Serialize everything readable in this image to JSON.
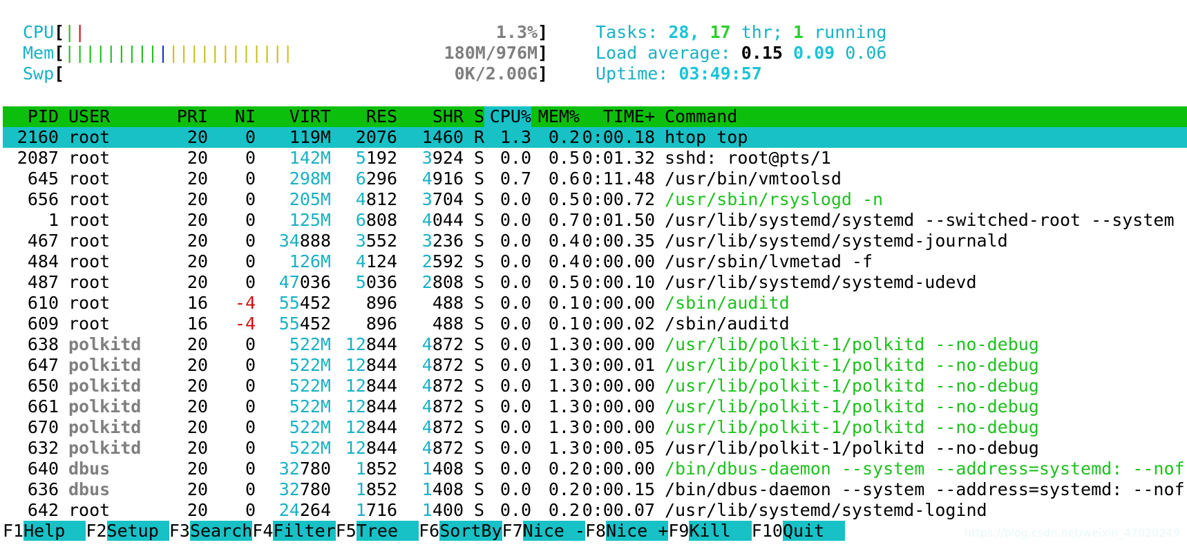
{
  "meters": {
    "cpu": {
      "label": "CPU",
      "bar_segments": [
        {
          "text": "|",
          "color": "green"
        },
        {
          "text": "|",
          "color": "red"
        }
      ],
      "value": "1.3%"
    },
    "mem": {
      "label": "Mem",
      "bar_segments": [
        {
          "text": "|||||||||",
          "color": "green"
        },
        {
          "text": "|",
          "color": "blue"
        },
        {
          "text": "||||||||||||",
          "color": "yellow"
        }
      ],
      "value": "180M/976M"
    },
    "swp": {
      "label": "Swp",
      "bar_segments": [],
      "value": "0K/2.00G"
    }
  },
  "stats": {
    "tasks_label": "Tasks: ",
    "tasks_count": "28",
    "threads": "17",
    "thr_label": " thr; ",
    "running": "1",
    "running_label": " running",
    "load_label": "Load average: ",
    "load1": "0.15",
    "load5": "0.09",
    "load15": "0.06",
    "uptime_label": "Uptime: ",
    "uptime": "03:49:57"
  },
  "table": {
    "headers": {
      "pid": "PID",
      "user": "USER",
      "pri": "PRI",
      "ni": "NI",
      "virt": "VIRT",
      "res": "RES",
      "shr": "SHR",
      "s": "S",
      "cpu": "CPU%",
      "mem": "MEM%",
      "time": "TIME+",
      "command": "Command"
    },
    "rows": [
      {
        "pid": "2160",
        "user": "root",
        "pri": "20",
        "ni": "0",
        "virt": "119M",
        "res": "2076",
        "shr": "1460",
        "s": "R",
        "cpu": "1.3",
        "mem": "0.2",
        "time": "0:00.18",
        "command": "htop top",
        "selected": true
      },
      {
        "pid": "2087",
        "user": "root",
        "pri": "20",
        "ni": "0",
        "virt": "142M",
        "res": "5192",
        "shr": "3924",
        "s": "S",
        "cpu": "0.0",
        "mem": "0.5",
        "time": "0:01.32",
        "command": "sshd: root@pts/1"
      },
      {
        "pid": "645",
        "user": "root",
        "pri": "20",
        "ni": "0",
        "virt": "298M",
        "res": "6296",
        "shr": "4916",
        "s": "S",
        "cpu": "0.7",
        "mem": "0.6",
        "time": "0:11.48",
        "command": "/usr/bin/vmtoolsd"
      },
      {
        "pid": "656",
        "user": "root",
        "pri": "20",
        "ni": "0",
        "virt": "205M",
        "res": "4812",
        "shr": "3704",
        "s": "S",
        "cpu": "0.0",
        "mem": "0.5",
        "time": "0:00.72",
        "command": "/usr/sbin/rsyslogd -n",
        "cmd_green": true
      },
      {
        "pid": "1",
        "user": "root",
        "pri": "20",
        "ni": "0",
        "virt": "125M",
        "res": "6808",
        "shr": "4044",
        "s": "S",
        "cpu": "0.0",
        "mem": "0.7",
        "time": "0:01.50",
        "command": "/usr/lib/systemd/systemd --switched-root --system"
      },
      {
        "pid": "467",
        "user": "root",
        "pri": "20",
        "ni": "0",
        "virt": "34888",
        "res": "3552",
        "shr": "3236",
        "s": "S",
        "cpu": "0.0",
        "mem": "0.4",
        "time": "0:00.35",
        "command": "/usr/lib/systemd/systemd-journald"
      },
      {
        "pid": "484",
        "user": "root",
        "pri": "20",
        "ni": "0",
        "virt": "126M",
        "res": "4124",
        "shr": "2592",
        "s": "S",
        "cpu": "0.0",
        "mem": "0.4",
        "time": "0:00.00",
        "command": "/usr/sbin/lvmetad -f"
      },
      {
        "pid": "487",
        "user": "root",
        "pri": "20",
        "ni": "0",
        "virt": "47036",
        "res": "5036",
        "shr": "2808",
        "s": "S",
        "cpu": "0.0",
        "mem": "0.5",
        "time": "0:00.10",
        "command": "/usr/lib/systemd/systemd-udevd"
      },
      {
        "pid": "610",
        "user": "root",
        "pri": "16",
        "ni": "-4",
        "virt": "55452",
        "res": "896",
        "shr": "488",
        "s": "S",
        "cpu": "0.0",
        "mem": "0.1",
        "time": "0:00.00",
        "command": "/sbin/auditd",
        "cmd_green": true
      },
      {
        "pid": "609",
        "user": "root",
        "pri": "16",
        "ni": "-4",
        "virt": "55452",
        "res": "896",
        "shr": "488",
        "s": "S",
        "cpu": "0.0",
        "mem": "0.1",
        "time": "0:00.02",
        "command": "/sbin/auditd"
      },
      {
        "pid": "638",
        "user": "polkitd",
        "pri": "20",
        "ni": "0",
        "virt": "522M",
        "res": "12844",
        "shr": "4872",
        "s": "S",
        "cpu": "0.0",
        "mem": "1.3",
        "time": "0:00.00",
        "command": "/usr/lib/polkit-1/polkitd --no-debug",
        "cmd_green": true
      },
      {
        "pid": "647",
        "user": "polkitd",
        "pri": "20",
        "ni": "0",
        "virt": "522M",
        "res": "12844",
        "shr": "4872",
        "s": "S",
        "cpu": "0.0",
        "mem": "1.3",
        "time": "0:00.01",
        "command": "/usr/lib/polkit-1/polkitd --no-debug",
        "cmd_green": true
      },
      {
        "pid": "650",
        "user": "polkitd",
        "pri": "20",
        "ni": "0",
        "virt": "522M",
        "res": "12844",
        "shr": "4872",
        "s": "S",
        "cpu": "0.0",
        "mem": "1.3",
        "time": "0:00.00",
        "command": "/usr/lib/polkit-1/polkitd --no-debug",
        "cmd_green": true
      },
      {
        "pid": "661",
        "user": "polkitd",
        "pri": "20",
        "ni": "0",
        "virt": "522M",
        "res": "12844",
        "shr": "4872",
        "s": "S",
        "cpu": "0.0",
        "mem": "1.3",
        "time": "0:00.00",
        "command": "/usr/lib/polkit-1/polkitd --no-debug",
        "cmd_green": true
      },
      {
        "pid": "670",
        "user": "polkitd",
        "pri": "20",
        "ni": "0",
        "virt": "522M",
        "res": "12844",
        "shr": "4872",
        "s": "S",
        "cpu": "0.0",
        "mem": "1.3",
        "time": "0:00.00",
        "command": "/usr/lib/polkit-1/polkitd --no-debug",
        "cmd_green": true
      },
      {
        "pid": "632",
        "user": "polkitd",
        "pri": "20",
        "ni": "0",
        "virt": "522M",
        "res": "12844",
        "shr": "4872",
        "s": "S",
        "cpu": "0.0",
        "mem": "1.3",
        "time": "0:00.05",
        "command": "/usr/lib/polkit-1/polkitd --no-debug"
      },
      {
        "pid": "640",
        "user": "dbus",
        "pri": "20",
        "ni": "0",
        "virt": "32780",
        "res": "1852",
        "shr": "1408",
        "s": "S",
        "cpu": "0.0",
        "mem": "0.2",
        "time": "0:00.00",
        "command": "/bin/dbus-daemon --system --address=systemd: --nof",
        "cmd_green": true
      },
      {
        "pid": "636",
        "user": "dbus",
        "pri": "20",
        "ni": "0",
        "virt": "32780",
        "res": "1852",
        "shr": "1408",
        "s": "S",
        "cpu": "0.0",
        "mem": "0.2",
        "time": "0:00.15",
        "command": "/bin/dbus-daemon --system --address=systemd: --nof"
      },
      {
        "pid": "642",
        "user": "root",
        "pri": "20",
        "ni": "0",
        "virt": "24264",
        "res": "1716",
        "shr": "1400",
        "s": "S",
        "cpu": "0.0",
        "mem": "0.2",
        "time": "0:00.07",
        "command": "/usr/lib/systemd/systemd-logind"
      }
    ]
  },
  "function_keys": [
    {
      "key": "F1",
      "label": "Help  "
    },
    {
      "key": "F2",
      "label": "Setup "
    },
    {
      "key": "F3",
      "label": "Search"
    },
    {
      "key": "F4",
      "label": "Filter"
    },
    {
      "key": "F5",
      "label": "Tree  "
    },
    {
      "key": "F6",
      "label": "SortBy"
    },
    {
      "key": "F7",
      "label": "Nice -"
    },
    {
      "key": "F8",
      "label": "Nice +"
    },
    {
      "key": "F9",
      "label": "Kill  "
    },
    {
      "key": "F10",
      "label": "Quit  "
    }
  ],
  "watermark": "https://blog.csdn.net/weixin_47020249",
  "colors": {
    "header_bg": "#0cbf0c",
    "selected_bg": "#17c1c6",
    "cyan": "#1ab0c4",
    "green": "#1fbf1f",
    "red": "#d01010"
  }
}
